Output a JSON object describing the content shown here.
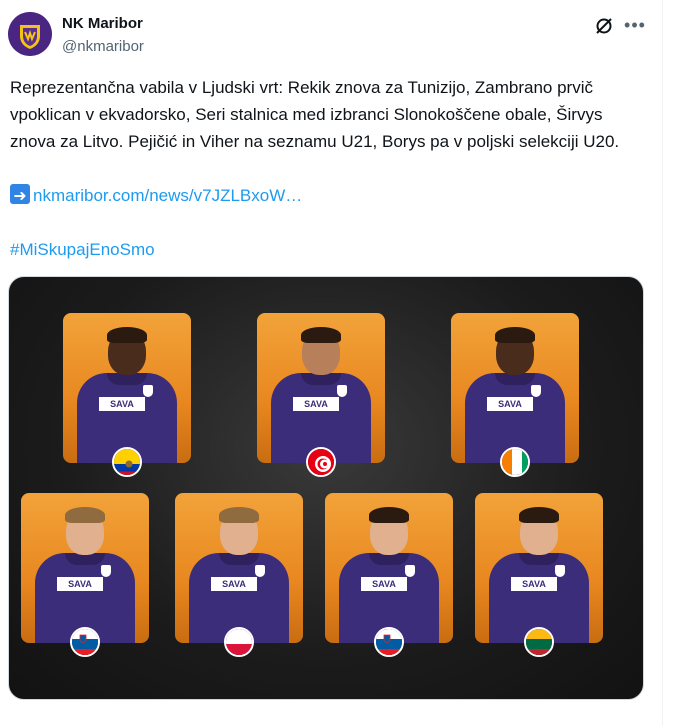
{
  "account": {
    "name": "NK Maribor",
    "handle": "@nkmaribor"
  },
  "tweet": {
    "text": "Reprezentančna vabila v Ljudski vrt: Rekik znova za Tunizijo, Zambrano prvič vpoklican v ekvadorsko, Seri stalnica med izbranci Slonokoščene obale, Širvys znova za Litvo. Pejičić in Viher na seznamu U21, Borys pa v poljski selekciji U20.",
    "link_text": "nkmaribor.com/news/v7JZLBxoW…",
    "hashtag": "#MiSkupajEnoSmo"
  },
  "icons": {
    "grok": "grok-icon",
    "more": "more-icon",
    "arrow_emoji": "right-arrow-emoji"
  },
  "media": {
    "players": [
      {
        "flag": "ecuador",
        "sponsor": "SAVA"
      },
      {
        "flag": "tunisia",
        "sponsor": "SAVA"
      },
      {
        "flag": "ivory-coast",
        "sponsor": "SAVA"
      },
      {
        "flag": "slovenia",
        "sponsor": "SAVA"
      },
      {
        "flag": "poland",
        "sponsor": "SAVA"
      },
      {
        "flag": "slovenia",
        "sponsor": "SAVA"
      },
      {
        "flag": "lithuania",
        "sponsor": "SAVA"
      }
    ]
  },
  "colors": {
    "link": "#1d9bf0",
    "handle": "#536471",
    "kit": "#3c2d7a",
    "card": "#e8871f"
  }
}
